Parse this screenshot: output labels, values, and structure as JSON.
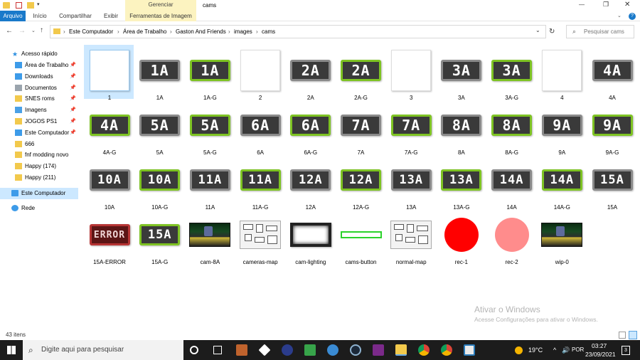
{
  "window": {
    "title": "cams",
    "context_tab": "Gerenciar",
    "minimize": "—",
    "maximize": "❐",
    "close": "✕"
  },
  "ribbon": {
    "tabs": [
      "Arquivo",
      "Início",
      "Compartilhar",
      "Exibir",
      "Ferramentas de Imagem"
    ]
  },
  "address": {
    "crumbs": [
      "Este Computador",
      "Área de Trabalho",
      "Gaston And Friends",
      "images",
      "cams"
    ],
    "search_placeholder": "Pesquisar cams"
  },
  "sidebar": {
    "quick_access": "Acesso rápido",
    "items": [
      {
        "label": "Área de Trabalho",
        "icon": "desktop-icon",
        "pinned": true
      },
      {
        "label": "Downloads",
        "icon": "download-icon",
        "pinned": true
      },
      {
        "label": "Documentos",
        "icon": "document-icon",
        "pinned": true
      },
      {
        "label": "SNES roms",
        "icon": "folder-icon",
        "pinned": true
      },
      {
        "label": "Imagens",
        "icon": "pictures-icon",
        "pinned": true
      },
      {
        "label": "JOGOS PS1",
        "icon": "folder-icon",
        "pinned": true
      },
      {
        "label": "Este Computador",
        "icon": "computer-icon",
        "pinned": true
      },
      {
        "label": "666",
        "icon": "folder-icon",
        "pinned": false
      },
      {
        "label": "fnf modding novo",
        "icon": "folder-icon",
        "pinned": false
      },
      {
        "label": "Happy (174)",
        "icon": "folder-icon",
        "pinned": false
      },
      {
        "label": "Happy (211)",
        "icon": "folder-icon",
        "pinned": false
      }
    ],
    "this_pc": "Este Computador",
    "network": "Rede",
    "pin_glyph": "📌"
  },
  "files": [
    {
      "name": "1",
      "kind": "blank",
      "text": ""
    },
    {
      "name": "1A",
      "kind": "n",
      "text": "1A"
    },
    {
      "name": "1A-G",
      "kind": "g",
      "text": "1A"
    },
    {
      "name": "2",
      "kind": "blank",
      "text": ""
    },
    {
      "name": "2A",
      "kind": "n",
      "text": "2A"
    },
    {
      "name": "2A-G",
      "kind": "g",
      "text": "2A"
    },
    {
      "name": "3",
      "kind": "blank",
      "text": ""
    },
    {
      "name": "3A",
      "kind": "n",
      "text": "3A"
    },
    {
      "name": "3A-G",
      "kind": "g",
      "text": "3A"
    },
    {
      "name": "4",
      "kind": "blank",
      "text": ""
    },
    {
      "name": "4A",
      "kind": "n",
      "text": "4A"
    },
    {
      "name": "4A-G",
      "kind": "g",
      "text": "4A"
    },
    {
      "name": "5A",
      "kind": "n",
      "text": "5A"
    },
    {
      "name": "5A-G",
      "kind": "g",
      "text": "5A"
    },
    {
      "name": "6A",
      "kind": "n",
      "text": "6A"
    },
    {
      "name": "6A-G",
      "kind": "g",
      "text": "6A"
    },
    {
      "name": "7A",
      "kind": "n",
      "text": "7A"
    },
    {
      "name": "7A-G",
      "kind": "g",
      "text": "7A"
    },
    {
      "name": "8A",
      "kind": "n",
      "text": "8A"
    },
    {
      "name": "8A-G",
      "kind": "g",
      "text": "8A"
    },
    {
      "name": "9A",
      "kind": "n",
      "text": "9A"
    },
    {
      "name": "9A-G",
      "kind": "g",
      "text": "9A"
    },
    {
      "name": "10A",
      "kind": "n",
      "text": "10A"
    },
    {
      "name": "10A-G",
      "kind": "g",
      "text": "10A"
    },
    {
      "name": "11A",
      "kind": "n",
      "text": "11A"
    },
    {
      "name": "11A-G",
      "kind": "g",
      "text": "11A"
    },
    {
      "name": "12A",
      "kind": "n",
      "text": "12A"
    },
    {
      "name": "12A-G",
      "kind": "g",
      "text": "12A"
    },
    {
      "name": "13A",
      "kind": "n",
      "text": "13A"
    },
    {
      "name": "13A-G",
      "kind": "g",
      "text": "13A"
    },
    {
      "name": "14A",
      "kind": "n",
      "text": "14A"
    },
    {
      "name": "14A-G",
      "kind": "g",
      "text": "14A"
    },
    {
      "name": "15A",
      "kind": "n",
      "text": "15A"
    },
    {
      "name": "15A-ERROR",
      "kind": "e",
      "text": "ERROR"
    },
    {
      "name": "15A-G",
      "kind": "g",
      "text": "15A"
    },
    {
      "name": "cam-8A",
      "kind": "scene",
      "text": ""
    },
    {
      "name": "cameras-map",
      "kind": "map",
      "text": ""
    },
    {
      "name": "cam-lighting",
      "kind": "lighting",
      "text": ""
    },
    {
      "name": "cams-button",
      "kind": "cambtn",
      "text": ""
    },
    {
      "name": "normal-map",
      "kind": "map",
      "text": ""
    },
    {
      "name": "rec-1",
      "kind": "circle",
      "text": "",
      "color": "#ff0000"
    },
    {
      "name": "rec-2",
      "kind": "circle",
      "text": "",
      "color": "#ff8c8c"
    },
    {
      "name": "wip-0",
      "kind": "scene",
      "text": ""
    }
  ],
  "status": {
    "count": "43 itens"
  },
  "watermark": {
    "title": "Ativar o Windows",
    "subtitle": "Acesse Configurações para ativar o Windows."
  },
  "taskbar": {
    "search_placeholder": "Digite aqui para pesquisar",
    "temperature": "19°C",
    "language": "POR",
    "time": "03:27",
    "date": "23/09/2021",
    "notification_count": "3"
  },
  "colors": {
    "accent": "#1979ca",
    "selection": "#cce8ff",
    "green_frame": "#7ec323",
    "gray_frame": "#8a8a8a"
  }
}
